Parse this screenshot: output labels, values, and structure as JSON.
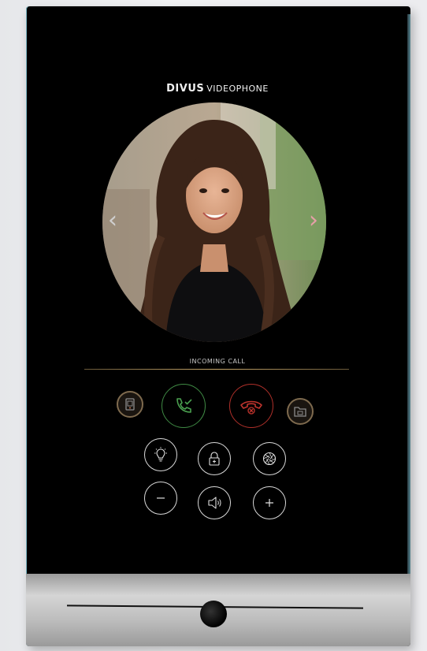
{
  "brand": {
    "name": "DIVUS",
    "product": "VIDEOPHONE"
  },
  "call": {
    "status": "INCOMING CALL"
  },
  "icons": {
    "prev": "chevron-left-icon",
    "next": "chevron-right-icon",
    "intercom": "intercom-panel-icon",
    "accept": "phone-accept-icon",
    "reject": "phone-reject-icon",
    "gallery": "gallery-folder-icon",
    "light": "light-bulb-icon",
    "door": "door-unlock-icon",
    "aperture": "camera-aperture-icon",
    "vol_down": "minus-icon",
    "speaker": "speaker-icon",
    "vol_up": "plus-icon"
  },
  "colors": {
    "accent_gold": "#c9a86a",
    "accept_green": "#3f8a44",
    "reject_red": "#b0302a",
    "control_white": "#d8d8d8"
  }
}
